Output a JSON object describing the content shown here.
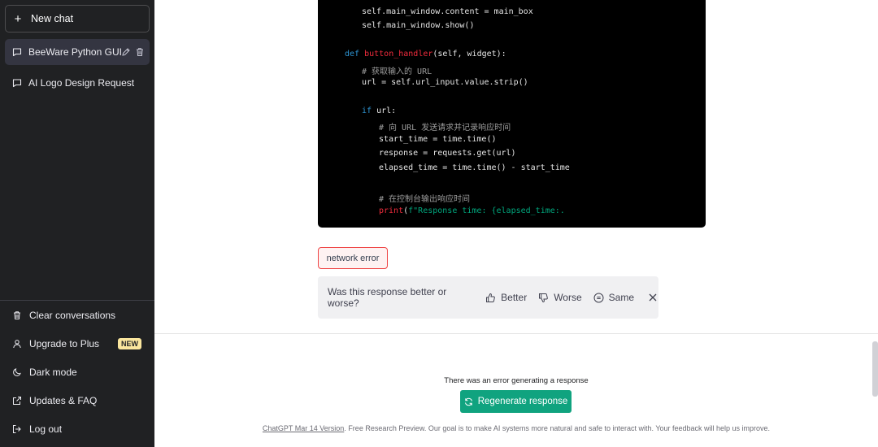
{
  "sidebar": {
    "new_chat_label": "New chat",
    "conversations": [
      {
        "label": "BeeWare Python GUI",
        "active": true
      },
      {
        "label": "AI Logo Design Request",
        "active": false
      }
    ],
    "menu": [
      {
        "label": "Clear conversations",
        "icon": "trash-icon"
      },
      {
        "label": "Upgrade to Plus",
        "icon": "user-icon",
        "badge": "NEW"
      },
      {
        "label": "Dark mode",
        "icon": "moon-icon"
      },
      {
        "label": "Updates & FAQ",
        "icon": "external-link-icon"
      },
      {
        "label": "Log out",
        "icon": "logout-icon"
      }
    ]
  },
  "code": {
    "lines": [
      {
        "indent": 1,
        "text": "self.main_window.content = main_box"
      },
      {
        "indent": 1,
        "text": "self.main_window.show()"
      },
      {
        "indent": 0,
        "kw": "def ",
        "fn": "button_handler",
        "text": "(self, widget):"
      },
      {
        "indent": 1,
        "comment": "# 获取输入的 URL"
      },
      {
        "indent": 1,
        "text": "url = self.url_input.value.strip()"
      },
      {
        "indent": 1,
        "kw": "if ",
        "text": "url:"
      },
      {
        "indent": 2,
        "comment": "# 向 URL 发送请求并记录响应时间"
      },
      {
        "indent": 2,
        "text": "start_time = time.time()"
      },
      {
        "indent": 2,
        "text": "response = requests.get(url)"
      },
      {
        "indent": 2,
        "text": "elapsed_time = time.time() - start_time"
      },
      {
        "indent": 2,
        "comment": "# 在控制台输出响应时间"
      },
      {
        "indent": 2,
        "fn": "print",
        "text": "(",
        "str": "f\"Response time: {elapsed_time:."
      }
    ]
  },
  "error_badge": "network error",
  "feedback": {
    "question": "Was this response better or worse?",
    "better": "Better",
    "worse": "Worse",
    "same": "Same"
  },
  "bottom": {
    "error_message": "There was an error generating a response",
    "regenerate_label": "Regenerate response",
    "footer_link": "ChatGPT Mar 14 Version",
    "footer_text": ". Free Research Preview. Our goal is to make AI systems more natural and safe to interact with. Your feedback will help us improve."
  },
  "colors": {
    "sidebar_bg": "#202123",
    "accent": "#10a37f",
    "error": "#ef4444"
  }
}
